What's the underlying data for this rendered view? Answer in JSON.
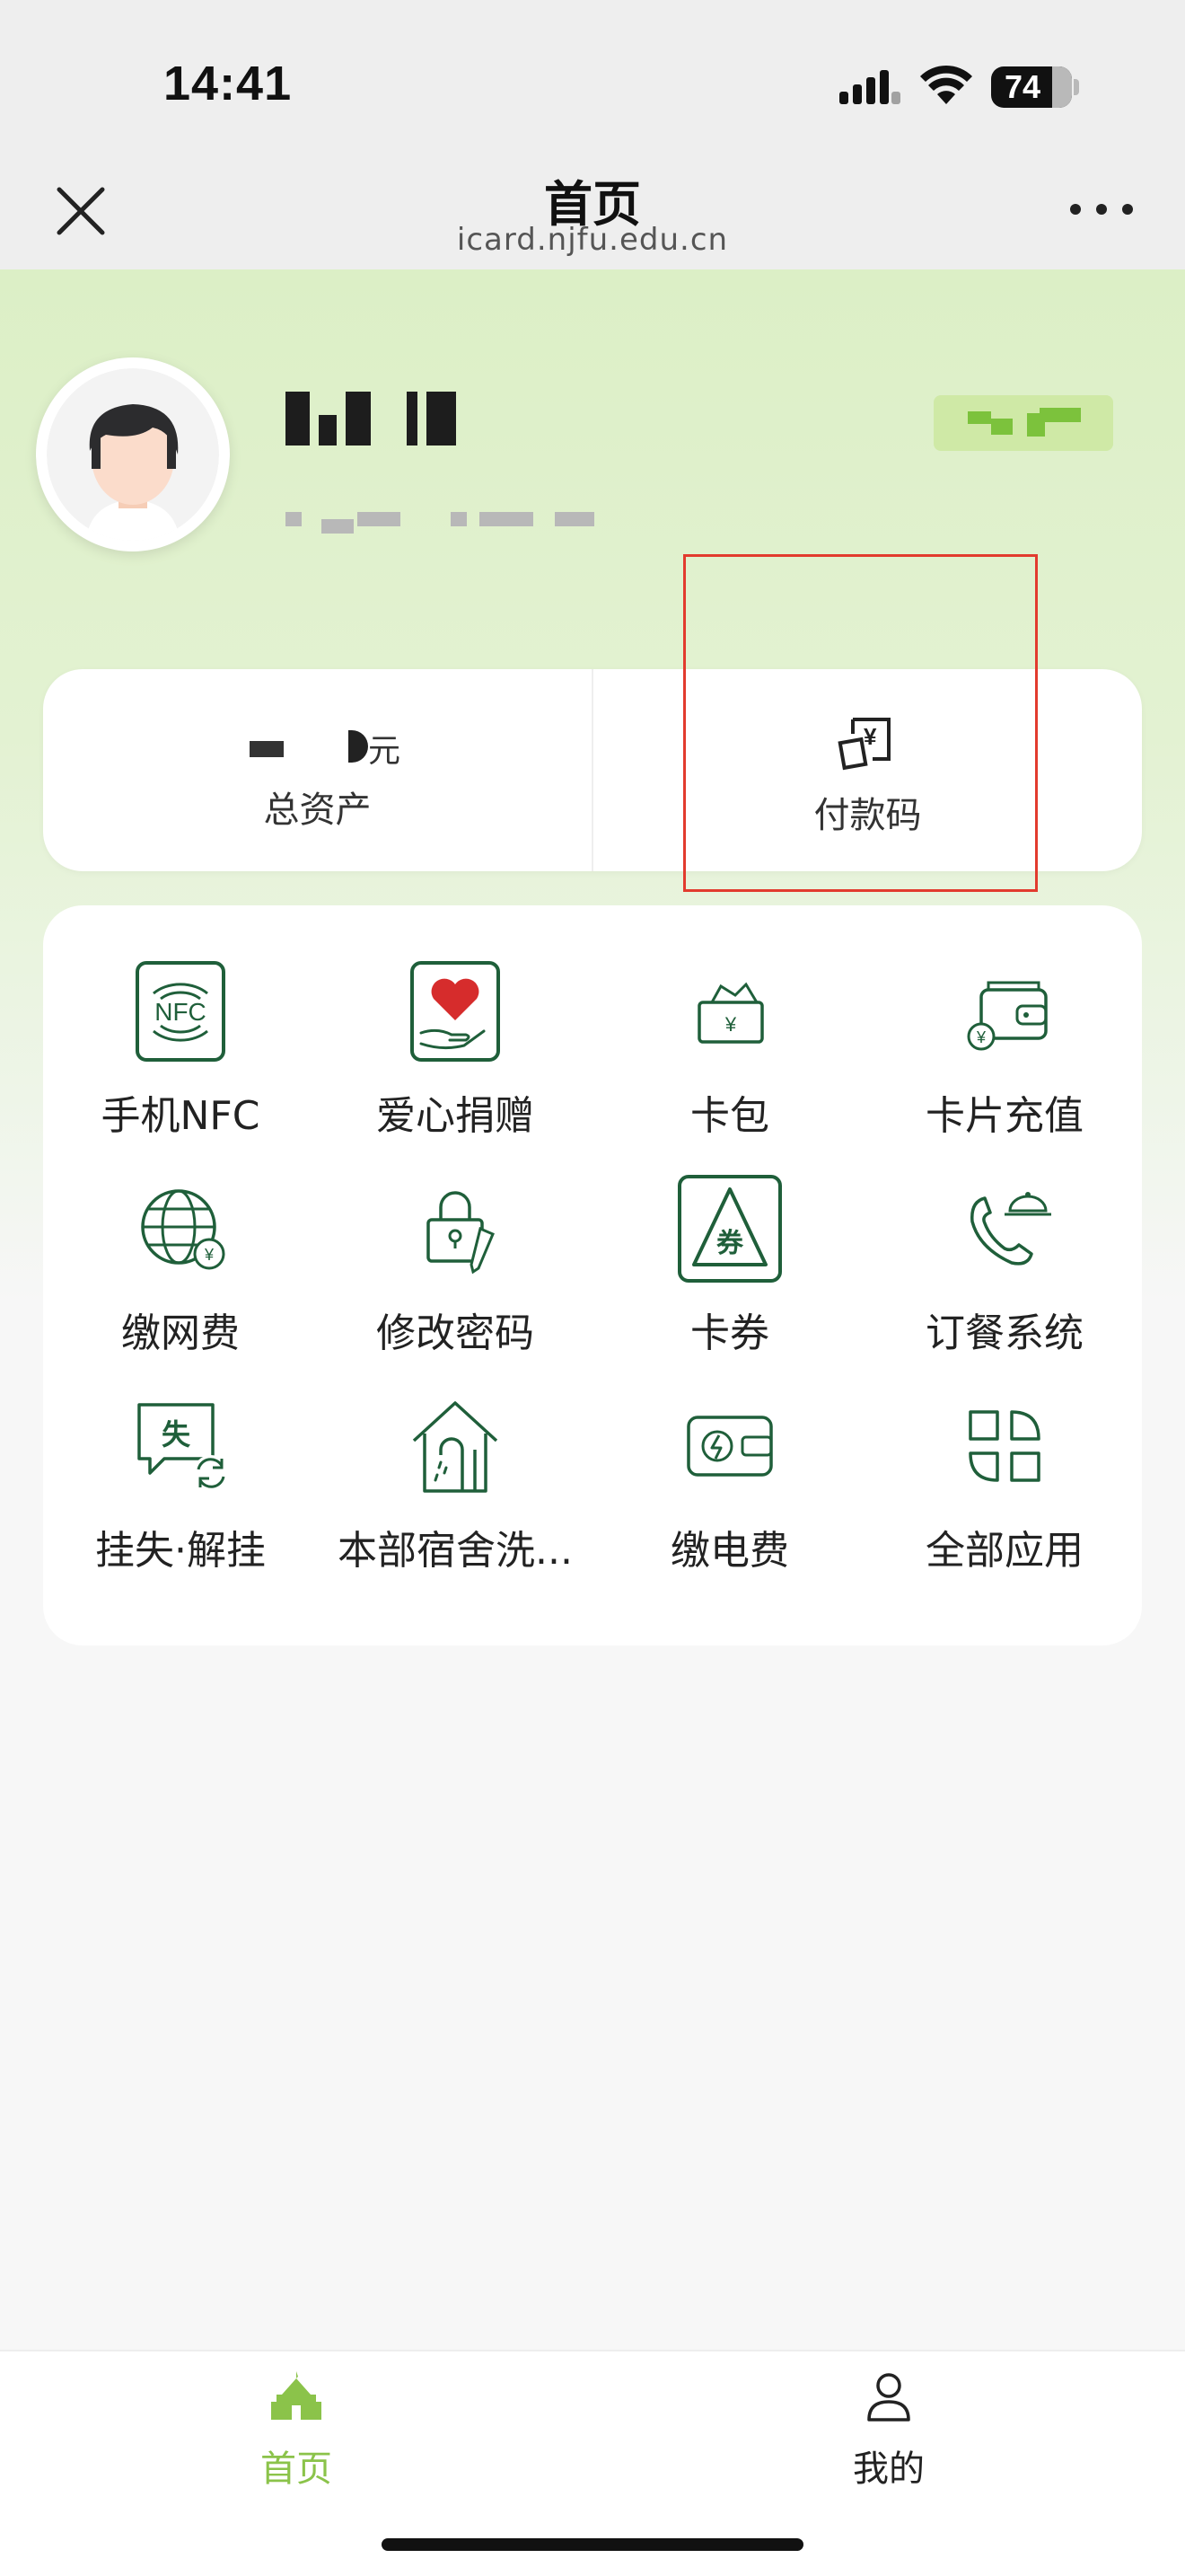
{
  "status_bar": {
    "time": "14:41",
    "battery": "74",
    "icons": [
      "signal-icon",
      "wifi-icon",
      "battery-icon"
    ]
  },
  "nav": {
    "title": "首页",
    "subtitle": "icard.njfu.edu.cn",
    "close_icon": "close-icon",
    "more_icon": "more-icon"
  },
  "asset": {
    "unit": "元",
    "label": "总资产"
  },
  "pay_code": {
    "label": "付款码",
    "icon": "payment-code-icon"
  },
  "apps": [
    {
      "label": "手机NFC",
      "icon": "nfc-icon"
    },
    {
      "label": "爱心捐赠",
      "icon": "donation-heart-icon"
    },
    {
      "label": "卡包",
      "icon": "card-wallet-icon"
    },
    {
      "label": "卡片充值",
      "icon": "recharge-wallet-icon"
    },
    {
      "label": "缴网费",
      "icon": "network-fee-icon"
    },
    {
      "label": "修改密码",
      "icon": "lock-edit-icon"
    },
    {
      "label": "卡券",
      "icon": "coupon-icon"
    },
    {
      "label": "订餐系统",
      "icon": "meal-order-icon"
    },
    {
      "label": "挂失·解挂",
      "icon": "report-loss-icon"
    },
    {
      "label": "本部宿舍洗...",
      "icon": "dorm-laundry-icon"
    },
    {
      "label": "缴电费",
      "icon": "electricity-fee-icon"
    },
    {
      "label": "全部应用",
      "icon": "all-apps-icon"
    }
  ],
  "tabs": [
    {
      "label": "首页",
      "icon": "home-icon",
      "active": true
    },
    {
      "label": "我的",
      "icon": "profile-icon",
      "active": false
    }
  ],
  "colors": {
    "accent": "#1f5f3a",
    "active_tab": "#8bc34a",
    "heart": "#d62c2c",
    "highlight": "#e23b2e"
  }
}
